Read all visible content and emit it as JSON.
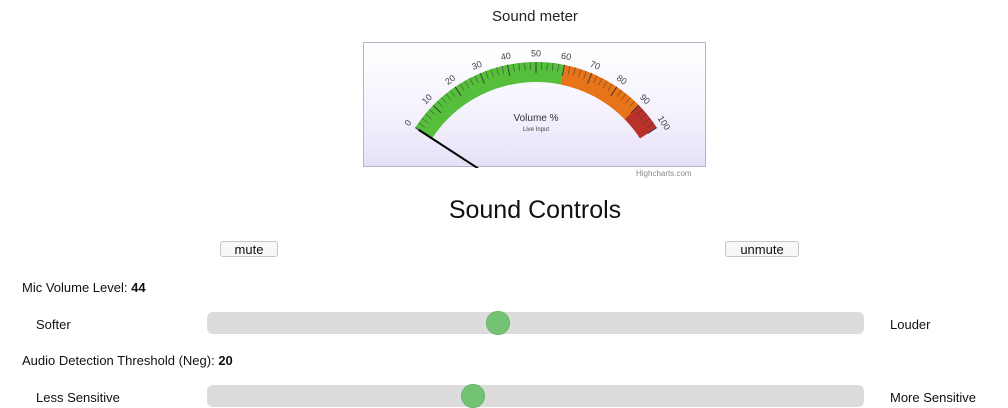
{
  "meter": {
    "title": "Sound meter",
    "pane_title": "Volume %",
    "pane_subtitle": "Live Input",
    "credits": "Highcharts.com",
    "min": 0,
    "max": 100,
    "value": 0,
    "tick_labels": [
      "0",
      "10",
      "20",
      "30",
      "40",
      "50",
      "60",
      "70",
      "80",
      "90",
      "100"
    ],
    "bands": [
      {
        "from": 0,
        "to": 60,
        "color": "#55BF3B"
      },
      {
        "from": 60,
        "to": 90,
        "color": "#E8741A"
      },
      {
        "from": 90,
        "to": 100,
        "color": "#B8312A"
      }
    ]
  },
  "controls": {
    "title": "Sound Controls",
    "mute_label": "mute",
    "unmute_label": "unmute",
    "mic": {
      "label": "Mic Volume Level:",
      "value": "44",
      "left_label": "Softer",
      "right_label": "Louder",
      "slider_fraction": 0.443
    },
    "threshold": {
      "label": "Audio Detection Threshold (Neg):",
      "value": "20",
      "left_label": "Less Sensitive",
      "right_label": "More Sensitive",
      "slider_fraction": 0.405
    }
  }
}
